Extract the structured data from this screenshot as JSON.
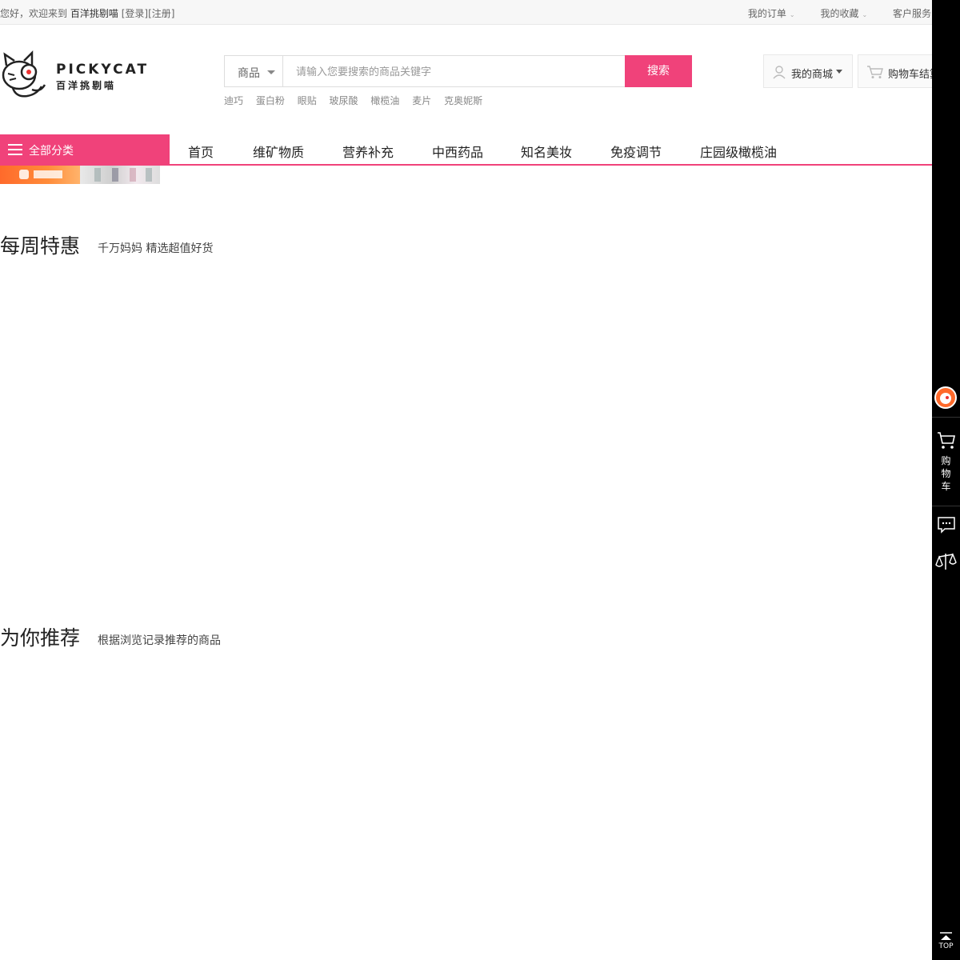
{
  "topbar": {
    "greeting": "您好，欢迎来到",
    "site_name": "百洋挑剔喵",
    "login": "[登录]",
    "register": "[注册]",
    "links": [
      "我的订单",
      "我的收藏",
      "客户服务"
    ]
  },
  "logo": {
    "brand_en": "PICKYCAT",
    "brand_cn": "百洋挑剔喵"
  },
  "search": {
    "category": "商品",
    "placeholder": "请输入您要搜索的商品关键字",
    "button": "搜索",
    "hotwords": [
      "迪巧",
      "蛋白粉",
      "眼贴",
      "玻尿酸",
      "橄榄油",
      "麦片",
      "克奥妮斯"
    ]
  },
  "header": {
    "my_mall": "我的商城",
    "cart": "购物车结算"
  },
  "nav": {
    "all_categories": "全部分类",
    "items": [
      "首页",
      "维矿物质",
      "营养补充",
      "中西药品",
      "知名美妆",
      "免疫调节",
      "庄园级橄榄油"
    ]
  },
  "sections": {
    "weekly": {
      "title": "每周特惠",
      "subtitle": "千万妈妈 精选超值好货"
    },
    "recommend": {
      "title": "为你推荐",
      "subtitle": "根据浏览记录推荐的商品"
    }
  },
  "sidebar": {
    "cart_label": [
      "购",
      "物",
      "车"
    ],
    "top_label": "TOP"
  },
  "colors": {
    "accent": "#f0427a",
    "sidebar": "#000000"
  }
}
